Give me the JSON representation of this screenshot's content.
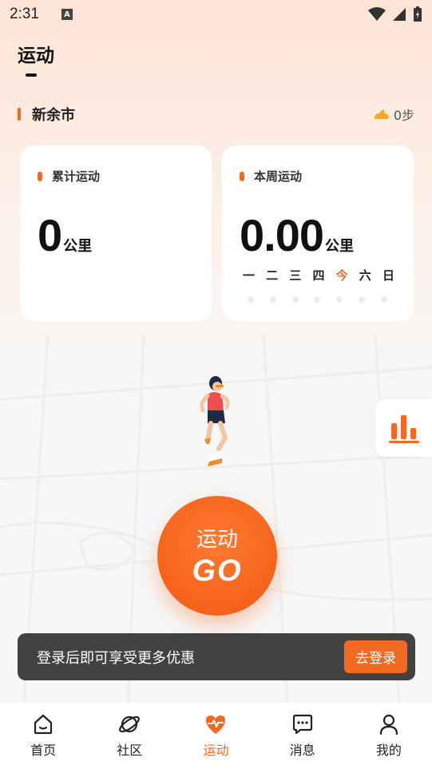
{
  "status_bar": {
    "time": "2:31",
    "indicator": "A"
  },
  "page": {
    "title": "运动"
  },
  "city": {
    "name": "新余市",
    "steps": "0步"
  },
  "cards": {
    "total": {
      "label": "累计运动",
      "value": "0",
      "unit": "公里"
    },
    "week": {
      "label": "本周运动",
      "value": "0.00",
      "unit": "公里",
      "days": [
        "一",
        "二",
        "三",
        "四",
        "今",
        "六",
        "日"
      ],
      "today_index": 4
    }
  },
  "go_button": {
    "label": "运动",
    "go": "GO"
  },
  "login_prompt": {
    "text": "登录后即可享受更多优惠",
    "button": "去登录"
  },
  "tabbar": {
    "items": [
      {
        "label": "首页",
        "icon": "home-icon"
      },
      {
        "label": "社区",
        "icon": "planet-icon"
      },
      {
        "label": "运动",
        "icon": "heart-pulse-icon",
        "active": true
      },
      {
        "label": "消息",
        "icon": "message-icon"
      },
      {
        "label": "我的",
        "icon": "user-icon"
      }
    ]
  },
  "colors": {
    "accent": "#f26a21",
    "text": "#222222",
    "card": "#ffffff"
  }
}
